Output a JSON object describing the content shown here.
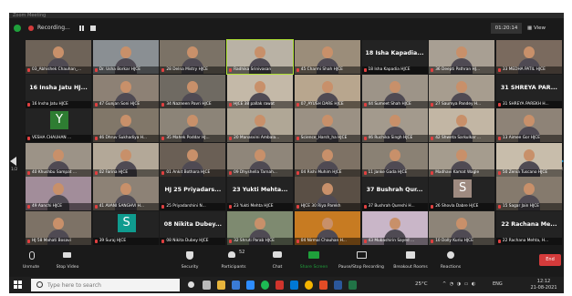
{
  "window": {
    "title": "Zoom Meeting"
  },
  "topbar": {
    "recording_label": "Recording...",
    "timer": "01:20:14",
    "view_label": "View"
  },
  "pager": {
    "left": "1/2",
    "right": "1/2"
  },
  "tiles": [
    {
      "label": "03_Abhishek Chauhan_...",
      "kind": "video",
      "avatar": "",
      "bg": "#6e6358"
    },
    {
      "label": "Dr. Usha Borkar HJCE",
      "kind": "video",
      "avatar": "",
      "bg": "#8a8f93"
    },
    {
      "label": "28 Delna Mistry HJCE",
      "kind": "video",
      "avatar": "",
      "bg": "#7b7266"
    },
    {
      "label": "Radhika Srinivasan",
      "kind": "video",
      "avatar": "",
      "bg": "#b9b2a5"
    },
    {
      "label": "45 Charmi Shah HJCE",
      "kind": "video",
      "avatar": "",
      "bg": "#9b8d7a"
    },
    {
      "label": "18 Isha Kapadia HJCE",
      "kind": "name",
      "name": "18 Isha Kapadia..."
    },
    {
      "label": "36 Deepti Pathran HJ...",
      "kind": "video",
      "avatar": "",
      "bg": "#a89f93"
    },
    {
      "label": "33 MEDHA PATIL HJCE",
      "kind": "video",
      "avatar": "",
      "bg": "#7a6a5e"
    },
    {
      "label": "16 Insha Jatu HJCE",
      "kind": "name",
      "name": "16 Insha Jatu HJ..."
    },
    {
      "label": "47 Gunjan Soni HJCE",
      "kind": "video",
      "avatar": "",
      "bg": "#8d8175"
    },
    {
      "label": "34 Nazneen Pavri HJCE",
      "kind": "video",
      "avatar": "",
      "bg": "#6f6a62"
    },
    {
      "label": "HJCE 38 pallak rawat",
      "kind": "video",
      "avatar": "",
      "bg": "#c4b9a8"
    },
    {
      "label": "07_AYUSH DARE HJCE",
      "kind": "video",
      "avatar": "",
      "bg": "#b8a68e"
    },
    {
      "label": "44 Sumeet Shah HJCE",
      "kind": "video",
      "avatar": "",
      "bg": "#9d9488"
    },
    {
      "label": "27 Saumya Pandey H...",
      "kind": "video",
      "avatar": "",
      "bg": "#a79d8f"
    },
    {
      "label": "31 SHREYA PAREKH H...",
      "kind": "name",
      "name": "31 SHREYA PAR..."
    },
    {
      "label": "VESHA CHAUHAN ...",
      "kind": "avatar",
      "avatar": "Y",
      "bg": "#2e7d32"
    },
    {
      "label": "46 Dhruv Sukhadiya H...",
      "kind": "video",
      "avatar": "",
      "bg": "#817769"
    },
    {
      "label": "35 Mahek Poddar HJ...",
      "kind": "video",
      "avatar": "",
      "bg": "#8c8478"
    },
    {
      "label": "20 Manasvini Ambala...",
      "kind": "video",
      "avatar": "",
      "bg": "#b0a796"
    },
    {
      "label": "Science_Harsh_ha HJCE",
      "kind": "video",
      "avatar": "",
      "bg": "#9b9184"
    },
    {
      "label": "46 Ruchika Singh HJCE",
      "kind": "video",
      "avatar": "",
      "bg": "#a39a8d"
    },
    {
      "label": "42 Shweta Sarkulkar ...",
      "kind": "video",
      "avatar": "",
      "bg": "#c2b6a4"
    },
    {
      "label": "13 Aimee Gor HJCE",
      "kind": "video",
      "avatar": "",
      "bg": "#8e8377"
    },
    {
      "label": "40 Khushbu Sampat ...",
      "kind": "video",
      "avatar": "",
      "bg": "#9c9387"
    },
    {
      "label": "02 Farina HJCE",
      "kind": "video",
      "avatar": "",
      "bg": "#b3a898"
    },
    {
      "label": "01 Ankit Bothara HJCE",
      "kind": "video",
      "avatar": "",
      "bg": "#6a5f55"
    },
    {
      "label": "09 Dhyshella Tarnah...",
      "kind": "video",
      "avatar": "",
      "bg": "#8f867a"
    },
    {
      "label": "04 Rishi Muhim HJCE",
      "kind": "video",
      "avatar": "",
      "bg": "#7e7265"
    },
    {
      "label": "11 Janke Gada HJCE",
      "kind": "video",
      "avatar": "",
      "bg": "#8a8174"
    },
    {
      "label": "Madhavi Kamat Wagle",
      "kind": "video",
      "avatar": "",
      "bg": "#a59c8e"
    },
    {
      "label": "50 Zenia Tuscano HJCE",
      "kind": "video",
      "avatar": "",
      "bg": "#c8bdab"
    },
    {
      "label": "49 Aanchi HJCE",
      "kind": "video",
      "avatar": "",
      "bg": "#a28d9a"
    },
    {
      "label": "41 AVANI SANGHVI H...",
      "kind": "video",
      "avatar": "",
      "bg": "#8d8276"
    },
    {
      "label": "25 Priyadarshini N...",
      "kind": "name",
      "name": "HJ 25 Priyadars..."
    },
    {
      "label": "23 Yukti Mehta HJCE",
      "kind": "name",
      "name": "23 Yukti Mehta..."
    },
    {
      "label": "HJCE 30 Riya Parekh",
      "kind": "video",
      "avatar": "",
      "bg": "#5a4f45"
    },
    {
      "label": "37 Bushrah Qureshi H...",
      "kind": "name",
      "name": "37 Bushrah Qur..."
    },
    {
      "label": "26 Shovla Dabre HJCE",
      "kind": "avatar",
      "avatar": "S",
      "bg": "#9e8a80"
    },
    {
      "label": "15 Sagar Jain HJCE",
      "kind": "video",
      "avatar": "",
      "bg": "#857a6d"
    },
    {
      "label": "HJ 58 Mahati Bosavi",
      "kind": "video",
      "avatar": "",
      "bg": "#7d7266"
    },
    {
      "label": "39 Suraj HJCE",
      "kind": "avatar",
      "avatar": "S",
      "bg": "#0f9b8e"
    },
    {
      "label": "08 Nikita Dubey HJCE",
      "kind": "name",
      "name": "08 Nikita Dubey..."
    },
    {
      "label": "32 Shruti Parab HJCE",
      "kind": "video",
      "avatar": "",
      "bg": "#7e8a70"
    },
    {
      "label": "04 Nirmal Chauhan H...",
      "kind": "video",
      "avatar": "",
      "bg": "#c77b22"
    },
    {
      "label": "43 Mubashirin Sayed ...",
      "kind": "video",
      "avatar": "",
      "bg": "#c9b6c8"
    },
    {
      "label": "10 Dolly Kuriu HJCE",
      "kind": "video",
      "avatar": "",
      "bg": "#8d8478"
    },
    {
      "label": "22 Rachana Mehta, H...",
      "kind": "name",
      "name": "22 Rachana Me..."
    }
  ],
  "toolbar": {
    "unmute": "Unmute",
    "stop_video": "Stop Video",
    "security": "Security",
    "participants": "Participants",
    "participants_count": "52",
    "chat": "Chat",
    "share_screen": "Share Screen",
    "pause_record": "Pause/Stop Recording",
    "breakout": "Breakout Rooms",
    "reactions": "Reactions",
    "end": "End"
  },
  "taskbar": {
    "search_placeholder": "Type here to search",
    "temperature": "25°C",
    "language": "ENG",
    "time": "12:12",
    "date": "21-08-2021"
  },
  "colors": {
    "accent_green": "#1fa03b",
    "end_red": "#d43b3b",
    "highlight": "#aee035",
    "pager_blue": "#1b9bd8"
  }
}
